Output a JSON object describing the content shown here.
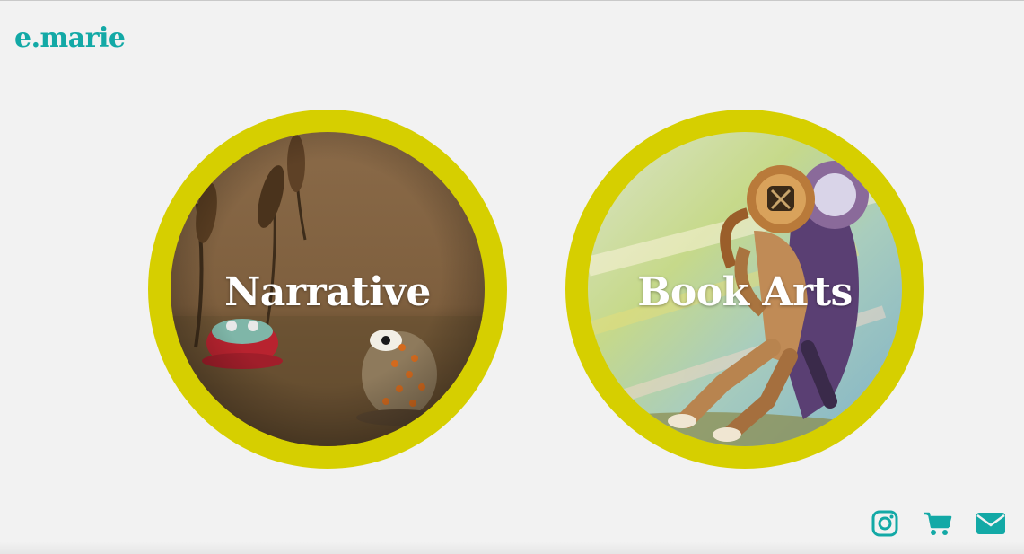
{
  "site": {
    "brand": "e.marie",
    "accent_color": "#13a9a6",
    "ring_color": "#d6cf00"
  },
  "portals": [
    {
      "label": "Narrative",
      "image": "painting of cattails and two toads"
    },
    {
      "label": "Book Arts",
      "image": "watercolor of two deep-sea divers embracing"
    }
  ],
  "social": {
    "icons": [
      "instagram-icon",
      "shopping-cart-icon",
      "envelope-icon"
    ]
  }
}
